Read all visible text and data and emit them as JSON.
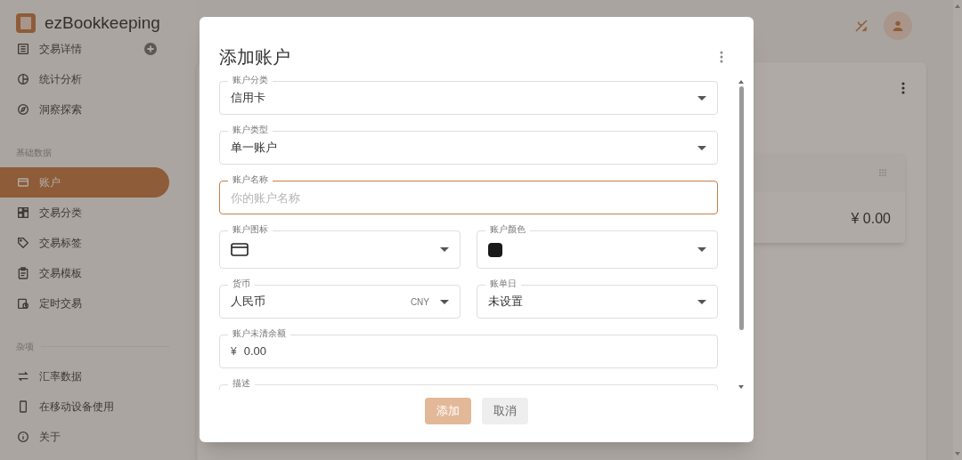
{
  "app": {
    "brand": "ezBookkeeping"
  },
  "sidebar": {
    "sections": [
      {
        "items": [
          {
            "label": "交易详情",
            "selected": false,
            "add_button": true
          },
          {
            "label": "统计分析",
            "selected": false
          },
          {
            "label": "洞察探索",
            "selected": false
          }
        ]
      },
      {
        "title": "基础数据",
        "items": [
          {
            "label": "账户",
            "selected": true
          },
          {
            "label": "交易分类",
            "selected": false
          },
          {
            "label": "交易标签",
            "selected": false
          },
          {
            "label": "交易模板",
            "selected": false
          },
          {
            "label": "定时交易",
            "selected": false
          }
        ]
      },
      {
        "title": "杂项",
        "items": [
          {
            "label": "汇率数据",
            "selected": false
          },
          {
            "label": "在移动设备使用",
            "selected": false
          },
          {
            "label": "关于",
            "selected": false
          }
        ]
      }
    ]
  },
  "background_card": {
    "amount": "¥ 0.00"
  },
  "dialog": {
    "title": "添加账户",
    "rows": [
      [
        {
          "kind": "select",
          "label": "账户分类",
          "value": "信用卡"
        }
      ],
      [
        {
          "kind": "select",
          "label": "账户类型",
          "value": "单一账户"
        }
      ],
      [
        {
          "kind": "input",
          "label": "账户名称",
          "placeholder": "你的账户名称",
          "focused": true
        }
      ],
      [
        {
          "kind": "icon_select",
          "label": "账户图标"
        },
        {
          "kind": "color_select",
          "label": "账户颜色",
          "color": "#1a1a1a"
        }
      ],
      [
        {
          "kind": "currency_select",
          "label": "货币",
          "value": "人民币",
          "code": "CNY"
        },
        {
          "kind": "select",
          "label": "账单日",
          "value": "未设置"
        }
      ],
      [
        {
          "kind": "amount",
          "label": "账户未清余额",
          "symbol": "¥",
          "value": "0.00"
        }
      ],
      [
        {
          "kind": "textarea",
          "label": "描述"
        }
      ]
    ],
    "buttons": [
      {
        "label": "添加",
        "kind": "primary"
      },
      {
        "label": "取消",
        "kind": "secondary"
      }
    ]
  }
}
